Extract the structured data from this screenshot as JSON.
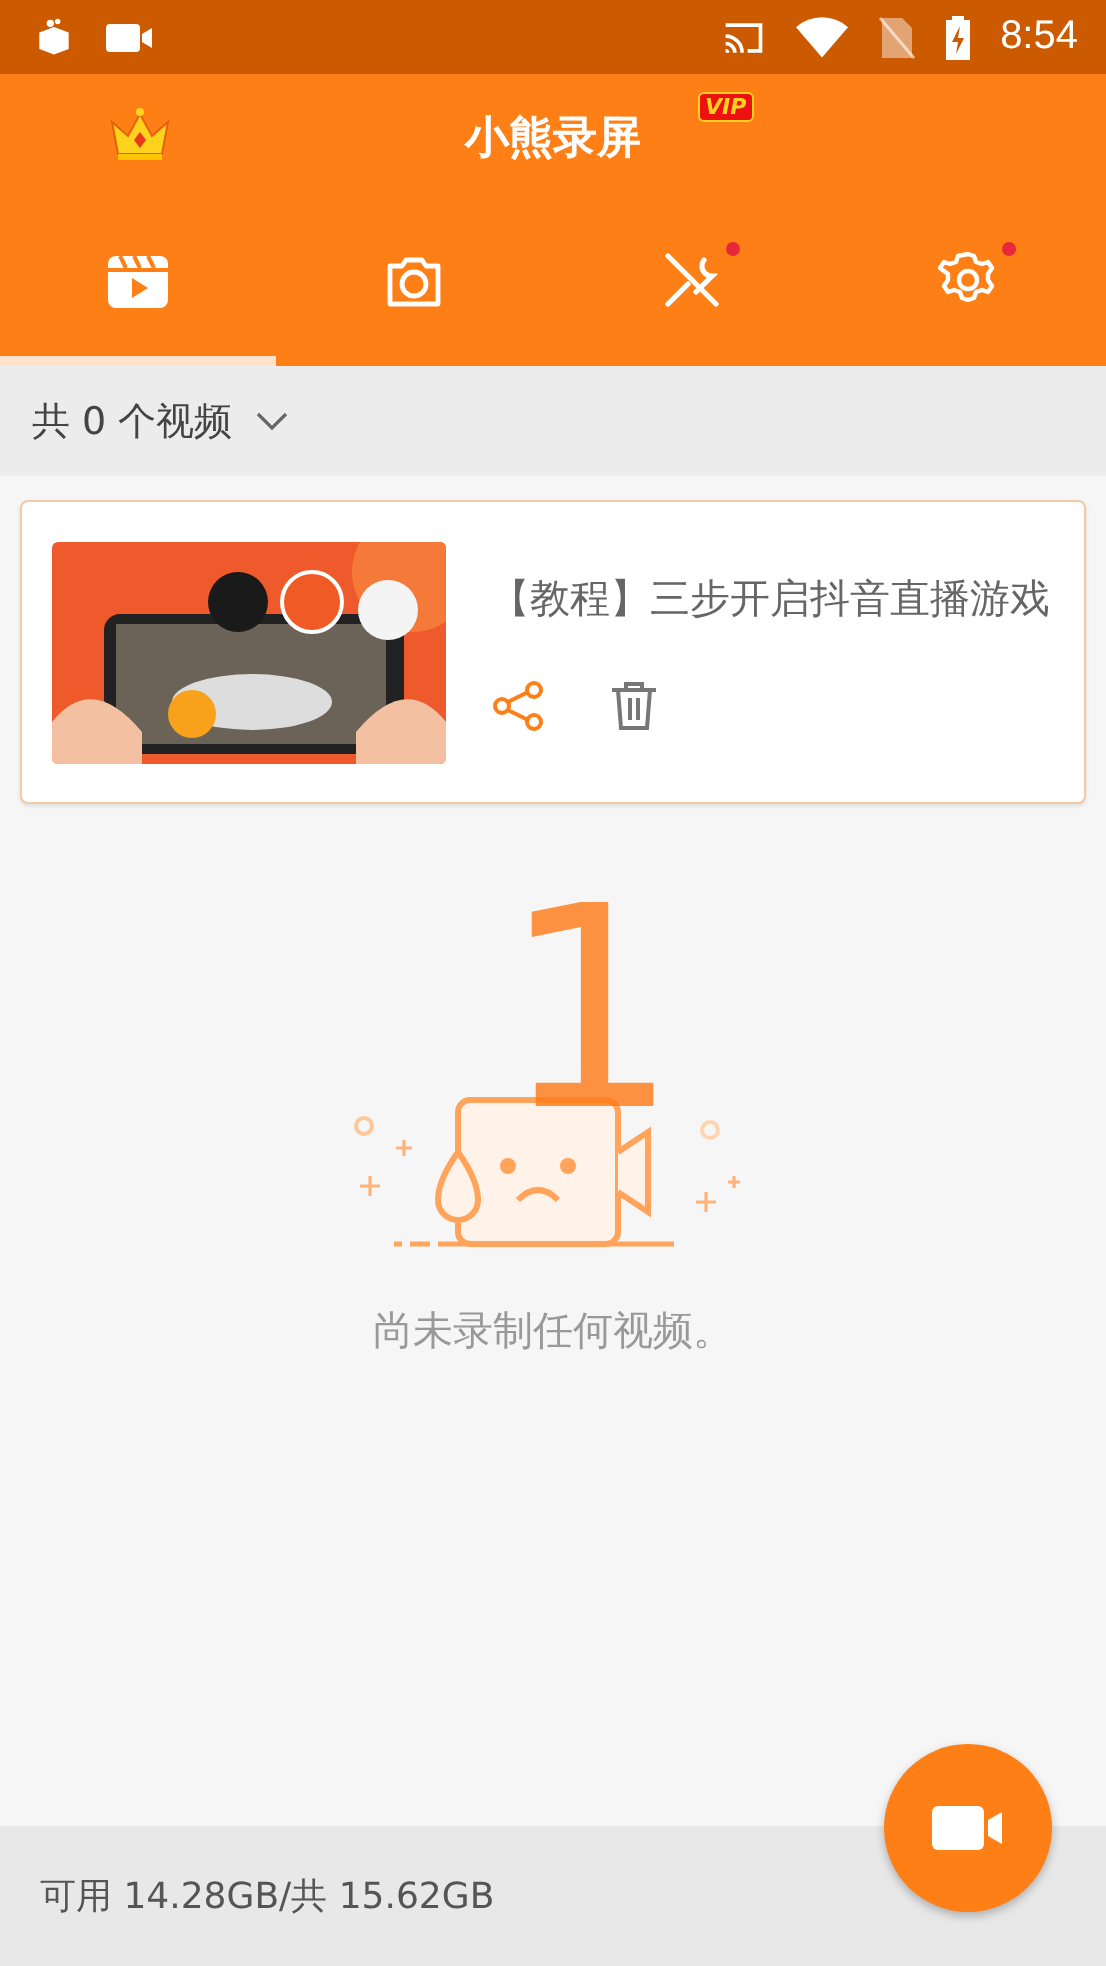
{
  "status_bar": {
    "time": "8:54"
  },
  "header": {
    "title": "小熊录屏",
    "vip_badge": "VIP"
  },
  "tabs": [
    {
      "kind": "video",
      "selected": true,
      "badge": false
    },
    {
      "kind": "camera",
      "selected": false,
      "badge": false
    },
    {
      "kind": "tools",
      "selected": false,
      "badge": true
    },
    {
      "kind": "settings",
      "selected": false,
      "badge": true
    }
  ],
  "filter": {
    "label": "共 0 个视频"
  },
  "videos": [
    {
      "kind": "picture",
      "title": "【教程】三步开启抖音直播游戏"
    }
  ],
  "empty_state": {
    "step_number": "1",
    "message": "尚未录制任何视频。"
  },
  "footer": {
    "storage": "可用 14.28GB/共 15.62GB"
  }
}
